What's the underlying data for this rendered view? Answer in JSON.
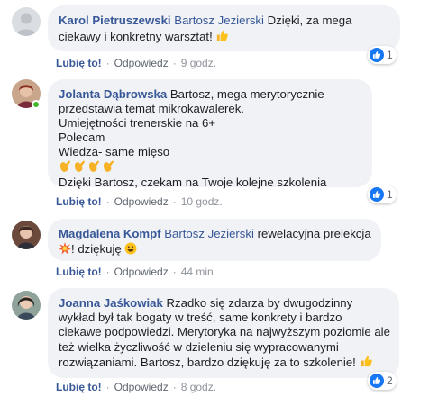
{
  "comments": [
    {
      "author": "Karol Pietruszewski",
      "tag": "Bartosz Jezierski",
      "lines": [
        "Dzięki, za mega",
        "ciekawy i konkretny warsztat!"
      ],
      "emoji": "thumbs-up",
      "like_label": "Lubię to!",
      "reply_label": "Odpowiedz",
      "time": "9 godz.",
      "reaction_count": "1"
    },
    {
      "author": "Jolanta Dąbrowska",
      "lines": [
        "Bartosz, mega merytorycznie",
        "przedstawia temat mikrokawalerek.",
        "Umiejętności trenerskie na 6+",
        "Polecam",
        "Wiedza- same mięso",
        "Dzięki Bartosz, czekam na Twoje kolejne szkolenia"
      ],
      "emoji": "clapping-hands x4",
      "like_label": "Lubię to!",
      "reply_label": "Odpowiedz",
      "time": "10 godz.",
      "reaction_count": "1",
      "online": true
    },
    {
      "author": "Magdalena Kompf",
      "tag": "Bartosz Jezierski",
      "lines": [
        "rewelacyjna prelekcja",
        "! dziękuję"
      ],
      "emoji": "collision, grinning-face",
      "like_label": "Lubię to!",
      "reply_label": "Odpowiedz",
      "time": "44 min"
    },
    {
      "author": "Joanna Jaśkowiak",
      "lines": [
        "Rzadko się zdarza by dwugodzinny",
        "wykład był tak bogaty w treść, same konkrety i bardzo",
        "ciekawe podpowiedzi. Merytoryka na najwyższym poziomie ale",
        "też wielka życzliwość w dzieleniu się wypracowanymi",
        "rozwiązaniami. Bartosz, bardzo dziękuję za to szkolenie!"
      ],
      "emoji": "thumbs-up",
      "like_label": "Lubię to!",
      "reply_label": "Odpowiedz",
      "time": "8 godz.",
      "reaction_count": "2"
    }
  ],
  "colors": {
    "author": "#385898",
    "bubble": "#f0f2f5",
    "meta": "#90949c",
    "like_reaction": "#1877f2"
  },
  "icons": {
    "reaction": "like-thumb-icon",
    "online": "online-status-dot"
  }
}
